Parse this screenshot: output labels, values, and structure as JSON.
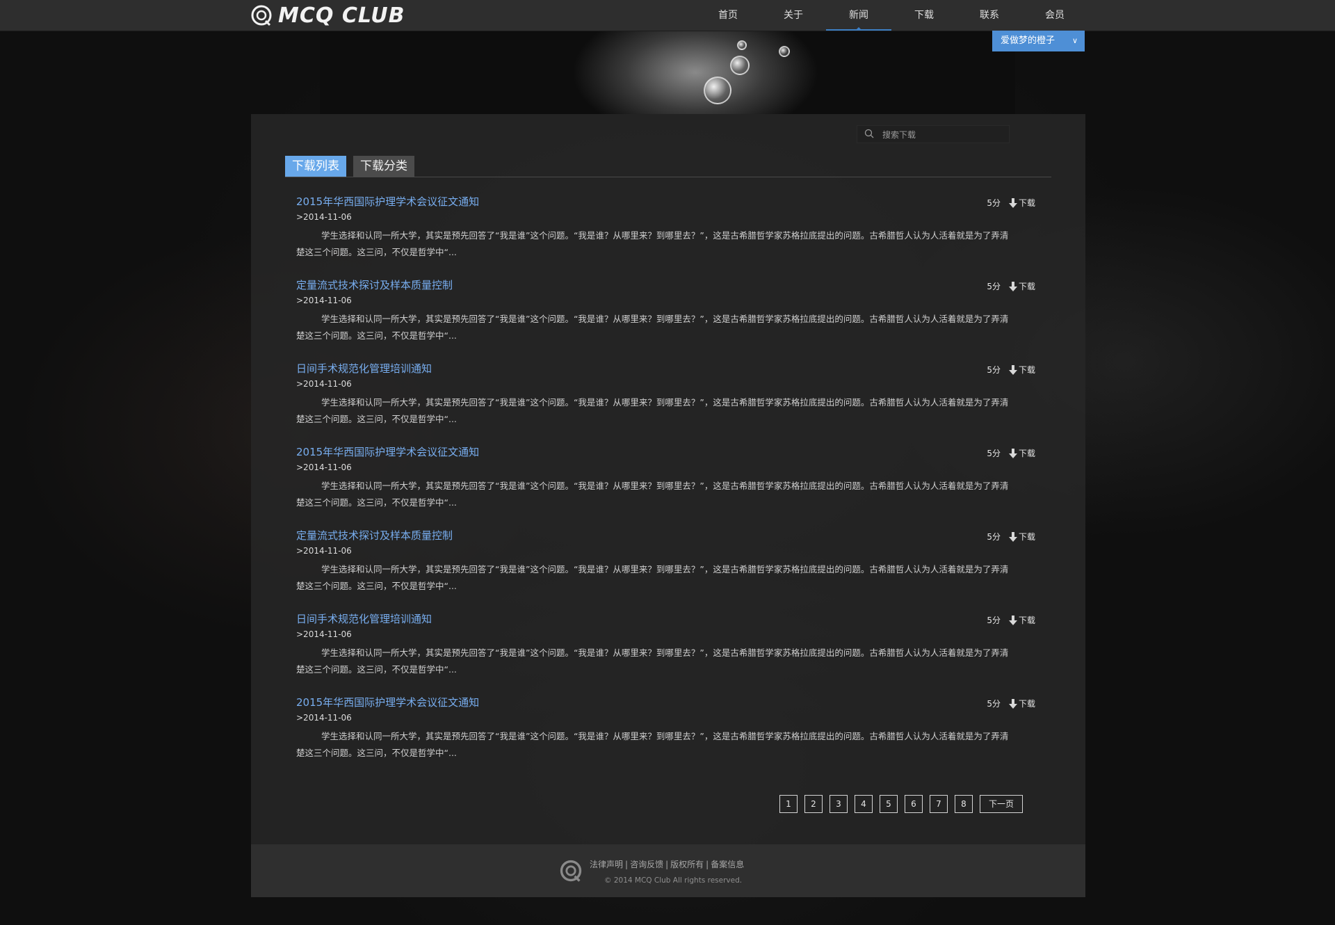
{
  "site": {
    "logo_text": "MCQ CLUB",
    "nav": [
      {
        "label": "首页"
      },
      {
        "label": "关于"
      },
      {
        "label": "新闻"
      },
      {
        "label": "下载"
      },
      {
        "label": "联系"
      },
      {
        "label": "会员"
      }
    ],
    "active_nav": "新闻",
    "user_name": "爱做梦的橙子"
  },
  "search": {
    "placeholder": "搜索下载"
  },
  "tabs": [
    {
      "label": "下载列表",
      "active": true
    },
    {
      "label": "下载分类",
      "active": false
    }
  ],
  "items": [
    {
      "title": "2015年华西国际护理学术会议征文通知",
      "date": ">2014-11-06",
      "score": "5分",
      "download_label": "下载",
      "desc": "学生选择和认同一所大学，其实是预先回答了“我是谁”这个问题。“我是谁？从哪里来？到哪里去？”，这是古希腊哲学家苏格拉底提出的问题。古希腊哲人认为人活着就是为了弄清楚这三个问题。这三问，不仅是哲学中“..."
    },
    {
      "title": "定量流式技术探讨及样本质量控制",
      "date": ">2014-11-06",
      "score": "5分",
      "download_label": "下载",
      "desc": "学生选择和认同一所大学，其实是预先回答了“我是谁”这个问题。“我是谁？从哪里来？到哪里去？”，这是古希腊哲学家苏格拉底提出的问题。古希腊哲人认为人活着就是为了弄清楚这三个问题。这三问，不仅是哲学中“..."
    },
    {
      "title": "日间手术规范化管理培训通知",
      "date": ">2014-11-06",
      "score": "5分",
      "download_label": "下载",
      "desc": "学生选择和认同一所大学，其实是预先回答了“我是谁”这个问题。“我是谁？从哪里来？到哪里去？”，这是古希腊哲学家苏格拉底提出的问题。古希腊哲人认为人活着就是为了弄清楚这三个问题。这三问，不仅是哲学中“..."
    },
    {
      "title": "2015年华西国际护理学术会议征文通知",
      "date": ">2014-11-06",
      "score": "5分",
      "download_label": "下载",
      "desc": "学生选择和认同一所大学，其实是预先回答了“我是谁”这个问题。“我是谁？从哪里来？到哪里去？”，这是古希腊哲学家苏格拉底提出的问题。古希腊哲人认为人活着就是为了弄清楚这三个问题。这三问，不仅是哲学中“..."
    },
    {
      "title": "定量流式技术探讨及样本质量控制",
      "date": ">2014-11-06",
      "score": "5分",
      "download_label": "下载",
      "desc": "学生选择和认同一所大学，其实是预先回答了“我是谁”这个问题。“我是谁？从哪里来？到哪里去？”，这是古希腊哲学家苏格拉底提出的问题。古希腊哲人认为人活着就是为了弄清楚这三个问题。这三问，不仅是哲学中“..."
    },
    {
      "title": "日间手术规范化管理培训通知",
      "date": ">2014-11-06",
      "score": "5分",
      "download_label": "下载",
      "desc": "学生选择和认同一所大学，其实是预先回答了“我是谁”这个问题。“我是谁？从哪里来？到哪里去？”，这是古希腊哲学家苏格拉底提出的问题。古希腊哲人认为人活着就是为了弄清楚这三个问题。这三问，不仅是哲学中“..."
    },
    {
      "title": "2015年华西国际护理学术会议征文通知",
      "date": ">2014-11-06",
      "score": "5分",
      "download_label": "下载",
      "desc": "学生选择和认同一所大学，其实是预先回答了“我是谁”这个问题。“我是谁？从哪里来？到哪里去？”，这是古希腊哲学家苏格拉底提出的问题。古希腊哲人认为人活着就是为了弄清楚这三个问题。这三问，不仅是哲学中“..."
    }
  ],
  "pagination": {
    "pages": [
      "1",
      "2",
      "3",
      "4",
      "5",
      "6",
      "7",
      "8"
    ],
    "next_label": "下一页"
  },
  "footer": {
    "links": [
      "法律声明",
      "咨询反馈",
      "版权所有",
      "备案信息"
    ],
    "copyright": "© 2014 MCQ Club All rights reserved."
  },
  "colors": {
    "accent": "#68a8ea",
    "link": "#78aef0",
    "user_menu": "#4e8fd6",
    "nav_active_underline": "#3d7fc4"
  },
  "icons": {
    "logo": "mcq-logo-icon",
    "search": "search-icon",
    "download": "download-arrow-icon",
    "dropdown": "chevron-down-icon"
  }
}
